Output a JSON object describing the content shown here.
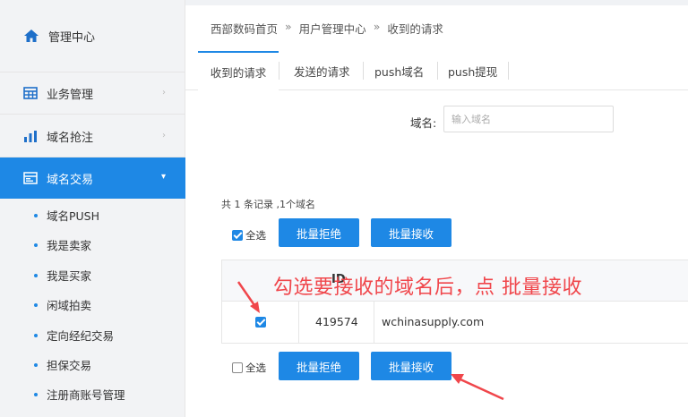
{
  "sidebar": {
    "home": "管理中心",
    "items": [
      {
        "label": "业务管理"
      },
      {
        "label": "域名抢注"
      },
      {
        "label": "域名交易"
      }
    ],
    "subitems": [
      "域名PUSH",
      "我是卖家",
      "我是买家",
      "闲域拍卖",
      "定向经纪交易",
      "担保交易",
      "注册商账号管理"
    ]
  },
  "breadcrumb": [
    "西部数码首页",
    "用户管理中心",
    "收到的请求"
  ],
  "breadcrumb_sep": "»",
  "tabs": [
    "收到的请求",
    "发送的请求",
    "push域名",
    "push提现"
  ],
  "search": {
    "label": "域名:",
    "placeholder": "输入域名"
  },
  "summary": "共 1 条记录 ,1个域名",
  "actions": {
    "select_all": "全选",
    "reject": "批量拒绝",
    "accept": "批量接收"
  },
  "table": {
    "id_header": "ID",
    "rows": [
      {
        "id": "419574",
        "domain": "wchinasupply.com"
      }
    ]
  },
  "annotation": "勾选要接收的域名后，点 批量接收",
  "colors": {
    "accent": "#1e88e5",
    "annotation": "#f0464b"
  }
}
